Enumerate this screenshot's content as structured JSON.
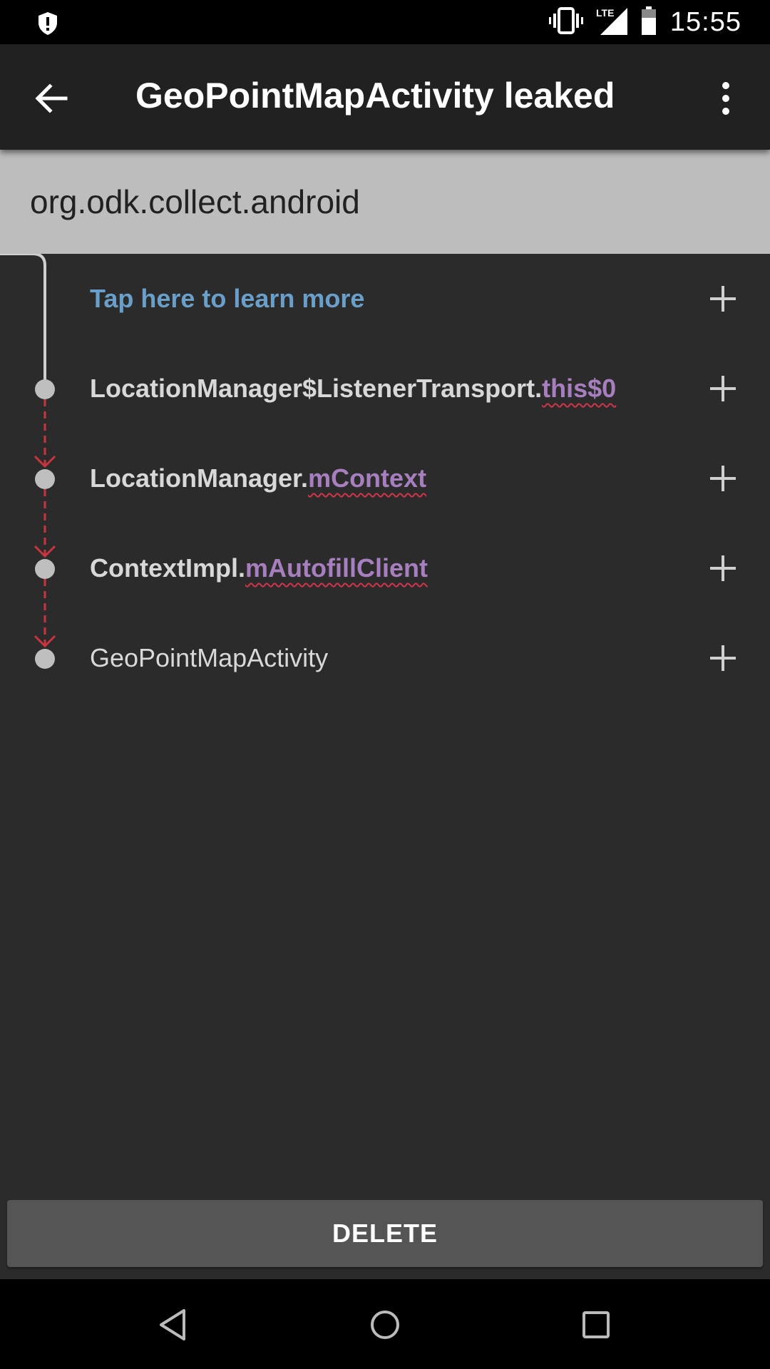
{
  "status_bar": {
    "time": "15:55",
    "lte_label": "LTE",
    "left_icon": "shield-alert-icon",
    "icons": [
      "vibrate-icon",
      "lte-signal-icon",
      "battery-icon"
    ]
  },
  "app_bar": {
    "title": "GeoPointMapActivity leaked",
    "back_icon": "arrow-back-icon",
    "menu_icon": "more-vert-icon"
  },
  "header": {
    "package": "org.odk.collect.android"
  },
  "trace": {
    "learn_more": "Tap here to learn more",
    "rows": [
      {
        "class": "LocationManager$ListenerTransport.",
        "field": "this$0"
      },
      {
        "class": "LocationManager.",
        "field": "mContext"
      },
      {
        "class": "ContextImpl.",
        "field": "mAutofillClient"
      },
      {
        "class": "GeoPointMapActivity",
        "field": ""
      }
    ],
    "expand_icon": "plus-icon"
  },
  "colors": {
    "link": "#6a9fc9",
    "field": "#a77fbf",
    "leak_path": "#c9343f",
    "node": "#bfbfbf"
  },
  "footer": {
    "delete_label": "DELETE"
  },
  "nav_bar": {
    "icons": [
      "nav-back-icon",
      "nav-home-icon",
      "nav-recents-icon"
    ]
  }
}
